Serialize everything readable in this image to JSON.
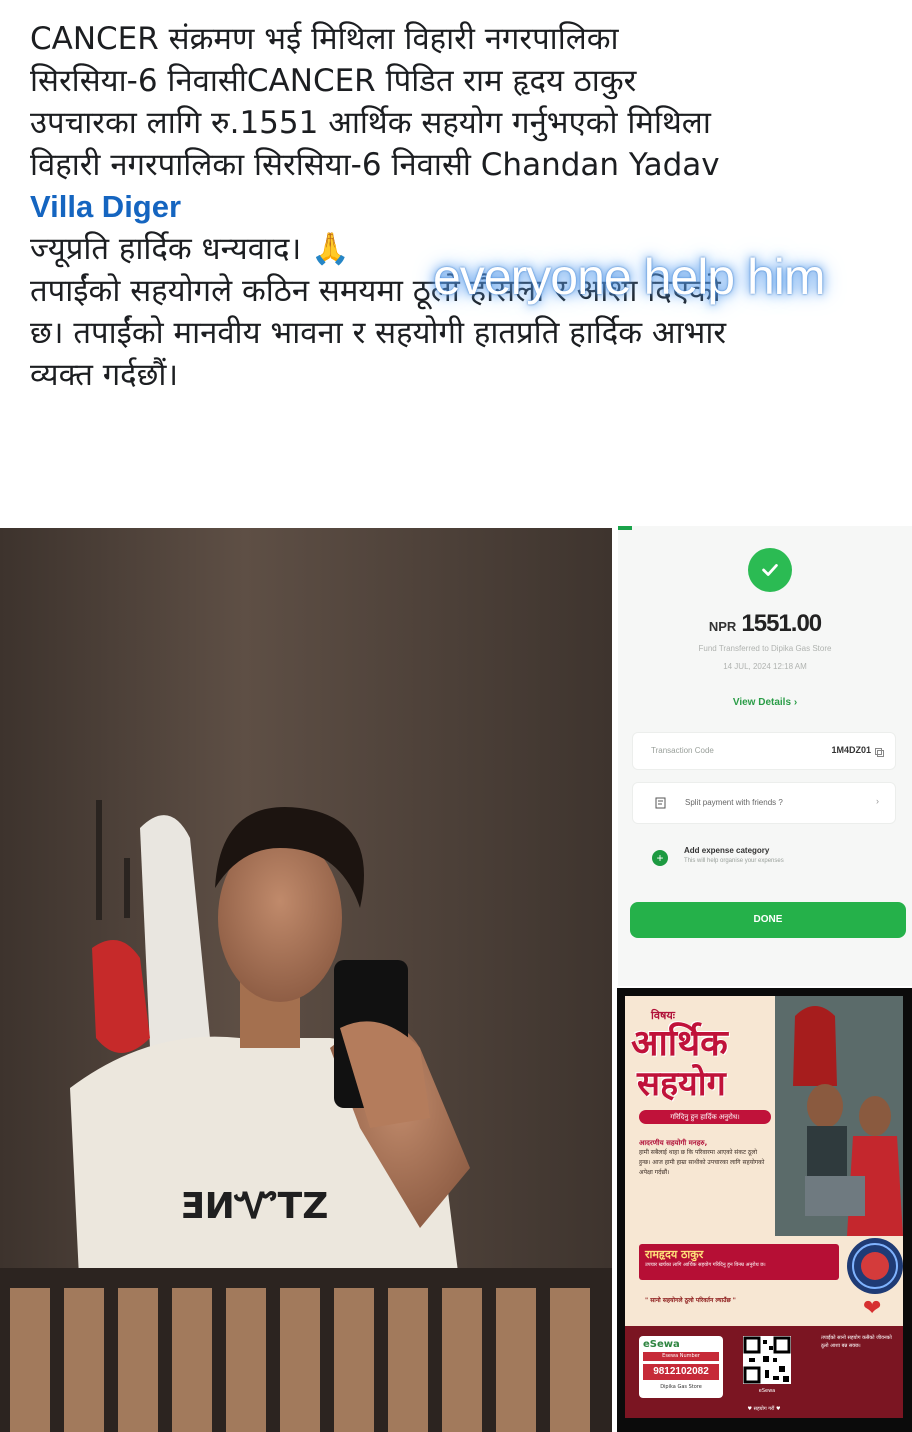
{
  "post": {
    "line1": "CANCER संक्रमण भई मिथिला विहारी नगरपालिका",
    "line2": "सिरसिया-6 निवासीCANCER पिडित राम हृदय ठाकुर",
    "line3": "उपचारका लागि रु.1551 आर्थिक सहयोग गर्नुभएको मिथिला",
    "line4": "विहारी नगरपालिका सिरसिया-6  निवासी Chandan Yadav",
    "mention": "Villa Diger",
    "line6": "ज्यूप्रति हार्दिक धन्यवाद। 🙏",
    "line7": "तपाईंको सहयोगले कठिन समयमा ठूलो हौसला र आशा दिएको",
    "line8": "छ। तपाईंको मानवीय भावना र सहयोगी हातप्रति हार्दिक आभार",
    "line9": "व्यक्त गर्दछौं।"
  },
  "overlay_text": "everyone help him",
  "photo": {
    "shirt_text": "ƎИᏉTZ"
  },
  "receipt": {
    "currency": "NPR",
    "amount": "1551.00",
    "transfer_text": "Fund Transferred to Dipika Gas Store",
    "date_text": "14 JUL, 2024 12:18 AM",
    "view_details": "View Details",
    "transaction_code_label": "Transaction Code",
    "transaction_code": "1M4DZ01",
    "split_payment": "Split payment with friends ?",
    "add_expense": "Add expense category",
    "add_expense_sub": "This will help organise your expenses",
    "done": "DONE",
    "accent": "#25b14a"
  },
  "poster": {
    "subject": "विषयः",
    "title1": "आर्थिक",
    "title2": "सहयोग",
    "ribbon": "गरिदिनु हुन हार्दिक अनुरोध।",
    "body_heading": "आदरणीय सहयोगी मनहरु,",
    "body": "हामी सबैलाई थाहा छ कि परिवारमा आएको संकट ठूलो हुन्छ। आज हामी हाम्रा साथीको उपचारका लागि सहयोगको अपेक्षा गर्दछौं।",
    "name": "रामहृदय ठाकुर",
    "name_sub": "उपचार खर्चका लागि आर्थिक सहयोग गरिदिनु हुन विनम्र अनुरोध छ।",
    "quote": "\" सानो सहयोगले ठूलो परिवर्तन ल्याउँछ \"",
    "sewa_logo": "eSewa",
    "sewa_label": "Esewa Number",
    "sewa_number": "9812102082",
    "store": "Dipika Gas Store",
    "qr_label": "eSewa",
    "side_text": "तपाईंको सानो सहयोग कसैको जीवनको ठूलो आशा बन्न सक्छ।",
    "footer": "♥ सहयोग गरौं ♥"
  }
}
